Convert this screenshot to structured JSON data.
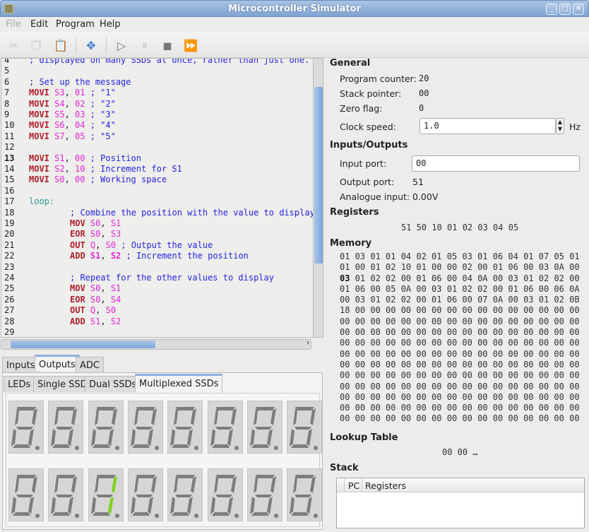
{
  "window": {
    "title": "Microcontroller Simulator"
  },
  "menu": [
    {
      "label": "File",
      "disabled": true
    },
    {
      "label": "Edit"
    },
    {
      "label": "Program"
    },
    {
      "label": "Help"
    }
  ],
  "toolbar": {
    "icons": [
      "cut-icon",
      "copy-icon",
      "paste-icon",
      "move-icon",
      "run-icon",
      "pause-icon",
      "stop-icon",
      "fast-forward-icon"
    ]
  },
  "editor": {
    "current_line": 13,
    "lines": [
      {
        "n": 4,
        "t": [
          [
            "cm",
            "; displayed on many SSDs at once, rather than just one."
          ]
        ]
      },
      {
        "n": 5,
        "t": []
      },
      {
        "n": 6,
        "t": [
          [
            "cm",
            "; Set up the message"
          ]
        ]
      },
      {
        "n": 7,
        "t": [
          [
            "kw",
            "MOVI"
          ],
          [
            "p",
            " "
          ],
          [
            "reg",
            "S3"
          ],
          [
            "p",
            ", "
          ],
          [
            "reg",
            "01"
          ],
          [
            "cm",
            " ; \"1\""
          ]
        ]
      },
      {
        "n": 8,
        "t": [
          [
            "kw",
            "MOVI"
          ],
          [
            "p",
            " "
          ],
          [
            "reg",
            "S4"
          ],
          [
            "p",
            ", "
          ],
          [
            "reg",
            "02"
          ],
          [
            "cm",
            " ; \"2\""
          ]
        ]
      },
      {
        "n": 9,
        "t": [
          [
            "kw",
            "MOVI"
          ],
          [
            "p",
            " "
          ],
          [
            "reg",
            "S5"
          ],
          [
            "p",
            ", "
          ],
          [
            "reg",
            "03"
          ],
          [
            "cm",
            " ; \"3\""
          ]
        ]
      },
      {
        "n": 10,
        "t": [
          [
            "kw",
            "MOVI"
          ],
          [
            "p",
            " "
          ],
          [
            "reg",
            "S6"
          ],
          [
            "p",
            ", "
          ],
          [
            "reg",
            "04"
          ],
          [
            "cm",
            " ; \"4\""
          ]
        ]
      },
      {
        "n": 11,
        "t": [
          [
            "kw",
            "MOVI"
          ],
          [
            "p",
            " "
          ],
          [
            "reg",
            "S7"
          ],
          [
            "p",
            ", "
          ],
          [
            "reg",
            "05"
          ],
          [
            "cm",
            " ; \"5\""
          ]
        ]
      },
      {
        "n": 12,
        "t": []
      },
      {
        "n": 13,
        "t": [
          [
            "kw",
            "MOVI"
          ],
          [
            "p",
            " "
          ],
          [
            "reg",
            "S1"
          ],
          [
            "p",
            ", "
          ],
          [
            "reg",
            "00"
          ],
          [
            "cm",
            " ; Position"
          ]
        ]
      },
      {
        "n": 14,
        "t": [
          [
            "kw",
            "MOVI"
          ],
          [
            "p",
            " "
          ],
          [
            "reg",
            "S2"
          ],
          [
            "p",
            ", "
          ],
          [
            "reg",
            "10"
          ],
          [
            "cm",
            " ; Increment for S1"
          ]
        ]
      },
      {
        "n": 15,
        "t": [
          [
            "kw",
            "MOVI"
          ],
          [
            "p",
            " "
          ],
          [
            "reg",
            "S0"
          ],
          [
            "p",
            ", "
          ],
          [
            "reg",
            "00"
          ],
          [
            "cm",
            " ; Working space"
          ]
        ]
      },
      {
        "n": 16,
        "t": []
      },
      {
        "n": 17,
        "t": [
          [
            "lbl",
            "loop:"
          ]
        ]
      },
      {
        "n": 18,
        "i": 1,
        "t": [
          [
            "cm",
            "; Combine the position with the value to display"
          ]
        ]
      },
      {
        "n": 19,
        "i": 1,
        "t": [
          [
            "kw",
            "MOV"
          ],
          [
            "p",
            " "
          ],
          [
            "reg",
            "S0"
          ],
          [
            "p",
            ", "
          ],
          [
            "reg",
            "S1"
          ]
        ]
      },
      {
        "n": 20,
        "i": 1,
        "t": [
          [
            "kw",
            "EOR"
          ],
          [
            "p",
            " "
          ],
          [
            "reg",
            "S0"
          ],
          [
            "p",
            ", "
          ],
          [
            "reg",
            "S3"
          ]
        ]
      },
      {
        "n": 21,
        "i": 1,
        "t": [
          [
            "kw",
            "OUT"
          ],
          [
            "p",
            " "
          ],
          [
            "reg",
            "Q"
          ],
          [
            "p",
            ", "
          ],
          [
            "reg",
            "S0"
          ],
          [
            "cm",
            " ; Output the value"
          ]
        ]
      },
      {
        "n": 22,
        "i": 1,
        "t": [
          [
            "kw",
            "ADD"
          ],
          [
            "p",
            " "
          ],
          [
            "regb",
            "S1"
          ],
          [
            "p",
            ", "
          ],
          [
            "regb",
            "S2"
          ],
          [
            "cm",
            " ; Increment the position"
          ]
        ]
      },
      {
        "n": 23,
        "t": []
      },
      {
        "n": 24,
        "i": 1,
        "t": [
          [
            "cm",
            "; Repeat for the other values to display"
          ]
        ]
      },
      {
        "n": 25,
        "i": 1,
        "t": [
          [
            "kw",
            "MOV"
          ],
          [
            "p",
            " "
          ],
          [
            "reg",
            "S0"
          ],
          [
            "p",
            ", "
          ],
          [
            "reg",
            "S1"
          ]
        ]
      },
      {
        "n": 26,
        "i": 1,
        "t": [
          [
            "kw",
            "EOR"
          ],
          [
            "p",
            " "
          ],
          [
            "reg",
            "S0"
          ],
          [
            "p",
            ", "
          ],
          [
            "reg",
            "S4"
          ]
        ]
      },
      {
        "n": 27,
        "i": 1,
        "t": [
          [
            "kw",
            "OUT"
          ],
          [
            "p",
            " "
          ],
          [
            "reg",
            "Q"
          ],
          [
            "p",
            ", "
          ],
          [
            "reg",
            "S0"
          ]
        ]
      },
      {
        "n": 28,
        "i": 1,
        "t": [
          [
            "kw",
            "ADD"
          ],
          [
            "p",
            " "
          ],
          [
            "reg",
            "S1"
          ],
          [
            "p",
            ", "
          ],
          [
            "reg",
            "S2"
          ]
        ]
      },
      {
        "n": 29,
        "t": []
      }
    ]
  },
  "io_tabs": [
    {
      "label": "Inputs"
    },
    {
      "label": "Outputs",
      "active": true
    },
    {
      "label": "ADC"
    }
  ],
  "output_tabs": [
    {
      "label": "LEDs"
    },
    {
      "label": "Single SSD"
    },
    {
      "label": "Dual SSDs"
    },
    {
      "label": "Multiplexed SSDs",
      "active": true
    }
  ],
  "ssd": {
    "lit_color": "#7ed321",
    "off_color": "#7d7d7b",
    "rows": [
      [
        [],
        [],
        [],
        [],
        [],
        [],
        [],
        []
      ],
      [
        [],
        [],
        [
          "b",
          "c"
        ],
        [],
        [],
        [],
        [],
        []
      ]
    ]
  },
  "general": {
    "heading": "General",
    "program_counter_label": "Program counter:",
    "program_counter": "20",
    "stack_pointer_label": "Stack pointer:",
    "stack_pointer": "00",
    "zero_flag_label": "Zero flag:",
    "zero_flag": "0",
    "clock_speed_label": "Clock speed:",
    "clock_speed": "1.0",
    "clock_unit": "Hz"
  },
  "io": {
    "heading": "Inputs/Outputs",
    "input_port_label": "Input port:",
    "input_port": "00",
    "output_port_label": "Output port:",
    "output_port": "51",
    "analogue_label": "Analogue input:",
    "analogue": "0.00V"
  },
  "registers": {
    "heading": "Registers",
    "values": "51 50 10 01 02 03 04 05"
  },
  "memory": {
    "heading": "Memory",
    "highlight": {
      "row": 2,
      "col": 0
    },
    "rows": [
      "01 03 01 01 04 02 01 05 03 01 06 04 01 07 05 01",
      "01 00 01 02 10 01 00 00 02 00 01 06 00 03 0A 00",
      "03 01 02 02 00 01 06 00 04 0A 00 03 01 02 02 00",
      "01 06 00 05 0A 00 03 01 02 02 00 01 06 00 06 0A",
      "00 03 01 02 02 00 01 06 00 07 0A 00 03 01 02 0B",
      "18 00 00 00 00 00 00 00 00 00 00 00 00 00 00 00",
      "00 00 00 00 00 00 00 00 00 00 00 00 00 00 00 00",
      "00 00 00 00 00 00 00 00 00 00 00 00 00 00 00 00",
      "00 00 00 00 00 00 00 00 00 00 00 00 00 00 00 00",
      "00 00 00 00 00 00 00 00 00 00 00 00 00 00 00 00",
      "00 00 00 00 00 00 00 00 00 00 00 00 00 00 00 00",
      "00 00 00 00 00 00 00 00 00 00 00 00 00 00 00 00",
      "00 00 00 00 00 00 00 00 00 00 00 00 00 00 00 00",
      "00 00 00 00 00 00 00 00 00 00 00 00 00 00 00 00",
      "00 00 00 00 00 00 00 00 00 00 00 00 00 00 00 00",
      "00 00 00 00 00 00 00 00 00 00 00 00 00 00 00 00"
    ]
  },
  "lookup": {
    "heading": "Lookup Table",
    "values": "00 00 …"
  },
  "stack": {
    "heading": "Stack",
    "columns": [
      "PC",
      "Registers"
    ]
  }
}
